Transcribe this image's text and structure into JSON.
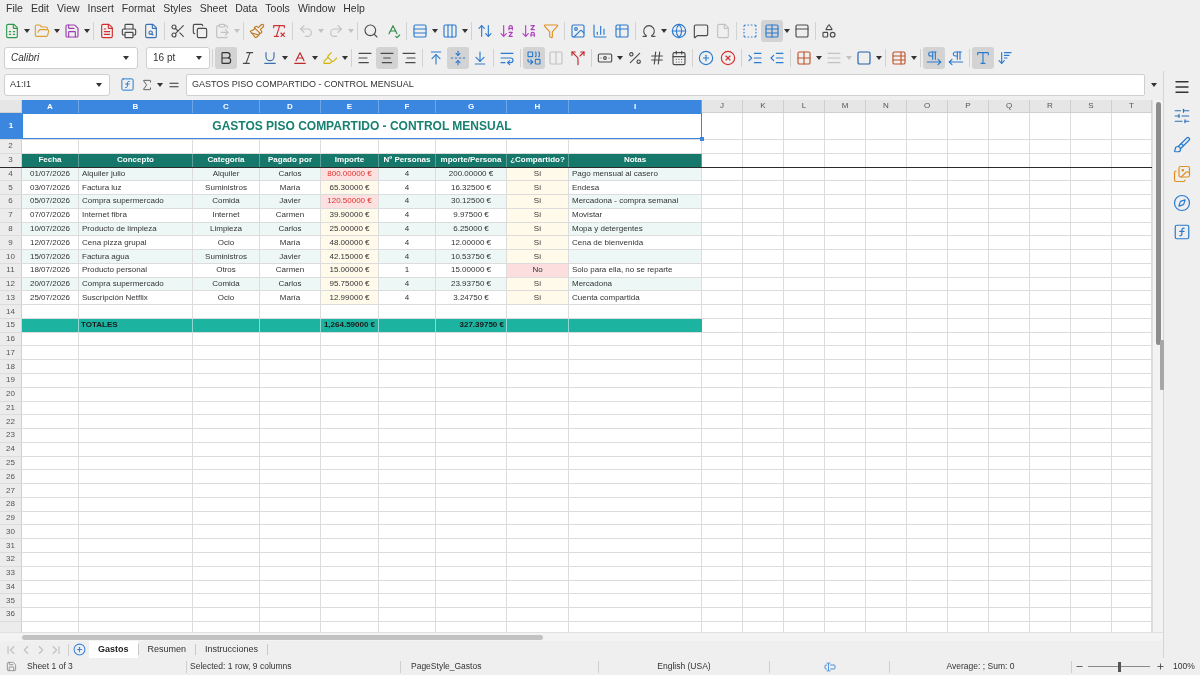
{
  "menu_bar": [
    "File",
    "Edit",
    "View",
    "Insert",
    "Format",
    "Styles",
    "Sheet",
    "Data",
    "Tools",
    "Window",
    "Help"
  ],
  "standard_toolbar": {
    "disabled": {
      "paste": true,
      "undo": true,
      "redo": true,
      "headers_footers": true
    },
    "active": {
      "freeze": true
    }
  },
  "formatting_toolbar": {
    "font_name": "Calibri",
    "font_size": "16 pt",
    "active": {
      "bold": true,
      "italic": false,
      "underline": false,
      "align_left": false,
      "align_center": true,
      "align_right": false,
      "align_top": false,
      "align_middle": true,
      "align_bottom": false,
      "wrap_text": false,
      "merge_center": true,
      "paragraph_ltr": true,
      "paragraph_rtl": false,
      "text_ltr": true,
      "text_ttb": false
    },
    "disabled": {
      "merge_cells": true,
      "border_style": true
    }
  },
  "formula_bar": {
    "name_box": "A1:I1",
    "formula": "GASTOS PISO COMPARTIDO - CONTROL MENSUAL"
  },
  "sheet": {
    "columns": [
      {
        "label": "A",
        "selected": true
      },
      {
        "label": "B",
        "selected": true
      },
      {
        "label": "C",
        "selected": true
      },
      {
        "label": "D",
        "selected": true
      },
      {
        "label": "E",
        "selected": true
      },
      {
        "label": "F",
        "selected": true
      },
      {
        "label": "G",
        "selected": true
      },
      {
        "label": "H",
        "selected": true
      },
      {
        "label": "I",
        "selected": true
      },
      {
        "label": "J",
        "selected": false
      },
      {
        "label": "K",
        "selected": false
      },
      {
        "label": "L",
        "selected": false
      },
      {
        "label": "M",
        "selected": false
      },
      {
        "label": "N",
        "selected": false
      },
      {
        "label": "O",
        "selected": false
      },
      {
        "label": "P",
        "selected": false
      },
      {
        "label": "Q",
        "selected": false
      },
      {
        "label": "R",
        "selected": false
      },
      {
        "label": "S",
        "selected": false
      },
      {
        "label": "T",
        "selected": false
      }
    ],
    "row_numbers": [
      {
        "label": "1",
        "selected": true
      },
      {
        "label": "2",
        "selected": false
      },
      {
        "label": "3",
        "selected": false
      },
      {
        "label": "4",
        "selected": false
      },
      {
        "label": "5",
        "selected": false
      },
      {
        "label": "6",
        "selected": false
      },
      {
        "label": "7",
        "selected": false
      },
      {
        "label": "8",
        "selected": false
      },
      {
        "label": "9",
        "selected": false
      },
      {
        "label": "10",
        "selected": false
      },
      {
        "label": "11",
        "selected": false
      },
      {
        "label": "12",
        "selected": false
      },
      {
        "label": "13",
        "selected": false
      },
      {
        "label": "14",
        "selected": false
      },
      {
        "label": "15",
        "selected": false
      },
      {
        "label": "16",
        "selected": false
      },
      {
        "label": "17",
        "selected": false
      },
      {
        "label": "18",
        "selected": false
      },
      {
        "label": "19",
        "selected": false
      },
      {
        "label": "20",
        "selected": false
      },
      {
        "label": "21",
        "selected": false
      },
      {
        "label": "22",
        "selected": false
      },
      {
        "label": "23",
        "selected": false
      },
      {
        "label": "24",
        "selected": false
      },
      {
        "label": "25",
        "selected": false
      },
      {
        "label": "26",
        "selected": false
      },
      {
        "label": "27",
        "selected": false
      },
      {
        "label": "28",
        "selected": false
      },
      {
        "label": "29",
        "selected": false
      },
      {
        "label": "30",
        "selected": false
      },
      {
        "label": "31",
        "selected": false
      },
      {
        "label": "32",
        "selected": false
      },
      {
        "label": "33",
        "selected": false
      },
      {
        "label": "34",
        "selected": false
      },
      {
        "label": "35",
        "selected": false
      },
      {
        "label": "36",
        "selected": false
      }
    ],
    "title": "GASTOS PISO COMPARTIDO - CONTROL MENSUAL",
    "table_headers": [
      "Fecha",
      "Concepto",
      "Categoría",
      "Pagado por",
      "Importe",
      "Nº Personas",
      "mporte/Persona",
      "¿Compartido?",
      "Notas"
    ],
    "rows": [
      {
        "fecha": "01/07/2026",
        "concepto": "Alquiler julio",
        "categoria": "Alquiler",
        "pagado_por": "Carlos",
        "importe": "800.00000 €",
        "personas": "4",
        "importe_persona": "200.00000 €",
        "compartido": "Sí",
        "notas": "Pago mensual al casero",
        "importe_highlighted": true,
        "compartido_highlighted": false
      },
      {
        "fecha": "03/07/2026",
        "concepto": "Factura luz",
        "categoria": "Suministros",
        "pagado_por": "María",
        "importe": "65.30000 €",
        "personas": "4",
        "importe_persona": "16.32500 €",
        "compartido": "Sí",
        "notas": "Endesa",
        "importe_highlighted": false,
        "compartido_highlighted": false
      },
      {
        "fecha": "05/07/2026",
        "concepto": "Compra supermercado",
        "categoria": "Comida",
        "pagado_por": "Javier",
        "importe": "120.50000 €",
        "personas": "4",
        "importe_persona": "30.12500 €",
        "compartido": "Sí",
        "notas": "Mercadona - compra semanal",
        "importe_highlighted": true,
        "compartido_highlighted": false
      },
      {
        "fecha": "07/07/2026",
        "concepto": "Internet fibra",
        "categoria": "Internet",
        "pagado_por": "Carmen",
        "importe": "39.90000 €",
        "personas": "4",
        "importe_persona": "9.97500 €",
        "compartido": "Sí",
        "notas": "Movistar",
        "importe_highlighted": false,
        "compartido_highlighted": false
      },
      {
        "fecha": "10/07/2026",
        "concepto": "Producto de limpieza",
        "categoria": "Limpieza",
        "pagado_por": "Carlos",
        "importe": "25.00000 €",
        "personas": "4",
        "importe_persona": "6.25000 €",
        "compartido": "Sí",
        "notas": "Mopa y detergentes",
        "importe_highlighted": false,
        "compartido_highlighted": false
      },
      {
        "fecha": "12/07/2026",
        "concepto": "Cena pizza grupal",
        "categoria": "Ocio",
        "pagado_por": "María",
        "importe": "48.00000 €",
        "personas": "4",
        "importe_persona": "12.00000 €",
        "compartido": "Sí",
        "notas": "Cena de bienvenida",
        "importe_highlighted": false,
        "compartido_highlighted": false
      },
      {
        "fecha": "15/07/2026",
        "concepto": "Factura agua",
        "categoria": "Suministros",
        "pagado_por": "Javier",
        "importe": "42.15000 €",
        "personas": "4",
        "importe_persona": "10.53750 €",
        "compartido": "Sí",
        "importe_highlighted": false,
        "compartido_highlighted": false
      },
      {
        "fecha": "18/07/2026",
        "concepto": "Producto personal",
        "categoria": "Otros",
        "pagado_por": "Carmen",
        "importe": "15.00000 €",
        "personas": "1",
        "importe_persona": "15.00000 €",
        "compartido": "No",
        "notas": "Solo para ella, no se reparte",
        "importe_highlighted": false,
        "compartido_highlighted": true
      },
      {
        "fecha": "20/07/2026",
        "concepto": "Compra supermercado",
        "categoria": "Comida",
        "pagado_por": "Carlos",
        "importe": "95.75000 €",
        "personas": "4",
        "importe_persona": "23.93750 €",
        "compartido": "Sí",
        "notas": "Mercadona",
        "importe_highlighted": false,
        "compartido_highlighted": false
      },
      {
        "fecha": "25/07/2026",
        "concepto": "Suscripción Netflix",
        "categoria": "Ocio",
        "pagado_por": "María",
        "importe": "12.99000 €",
        "personas": "4",
        "importe_persona": "3.24750 €",
        "compartido": "Sí",
        "notas": "Cuenta compartida",
        "importe_highlighted": false,
        "compartido_highlighted": false
      }
    ],
    "totals": {
      "label": "TOTALES",
      "importe": "1,264.59000 €",
      "importe_persona": "327.39750 €"
    }
  },
  "sheet_tabs": {
    "nav_disabled": true,
    "tabs": [
      {
        "label": "Gastos",
        "selected": true
      },
      {
        "label": "Resumen",
        "selected": false
      },
      {
        "label": "Instrucciones",
        "selected": false
      }
    ]
  },
  "status_bar": {
    "sheet": "Sheet 1 of 3",
    "selection": "Selected: 1 row, 9 columns",
    "page_style": "PageStyle_Gastos",
    "language": "English (USA)",
    "sum": "Average: ; Sum: 0",
    "zoom": {
      "level": 0.5,
      "reading": "100%"
    }
  }
}
